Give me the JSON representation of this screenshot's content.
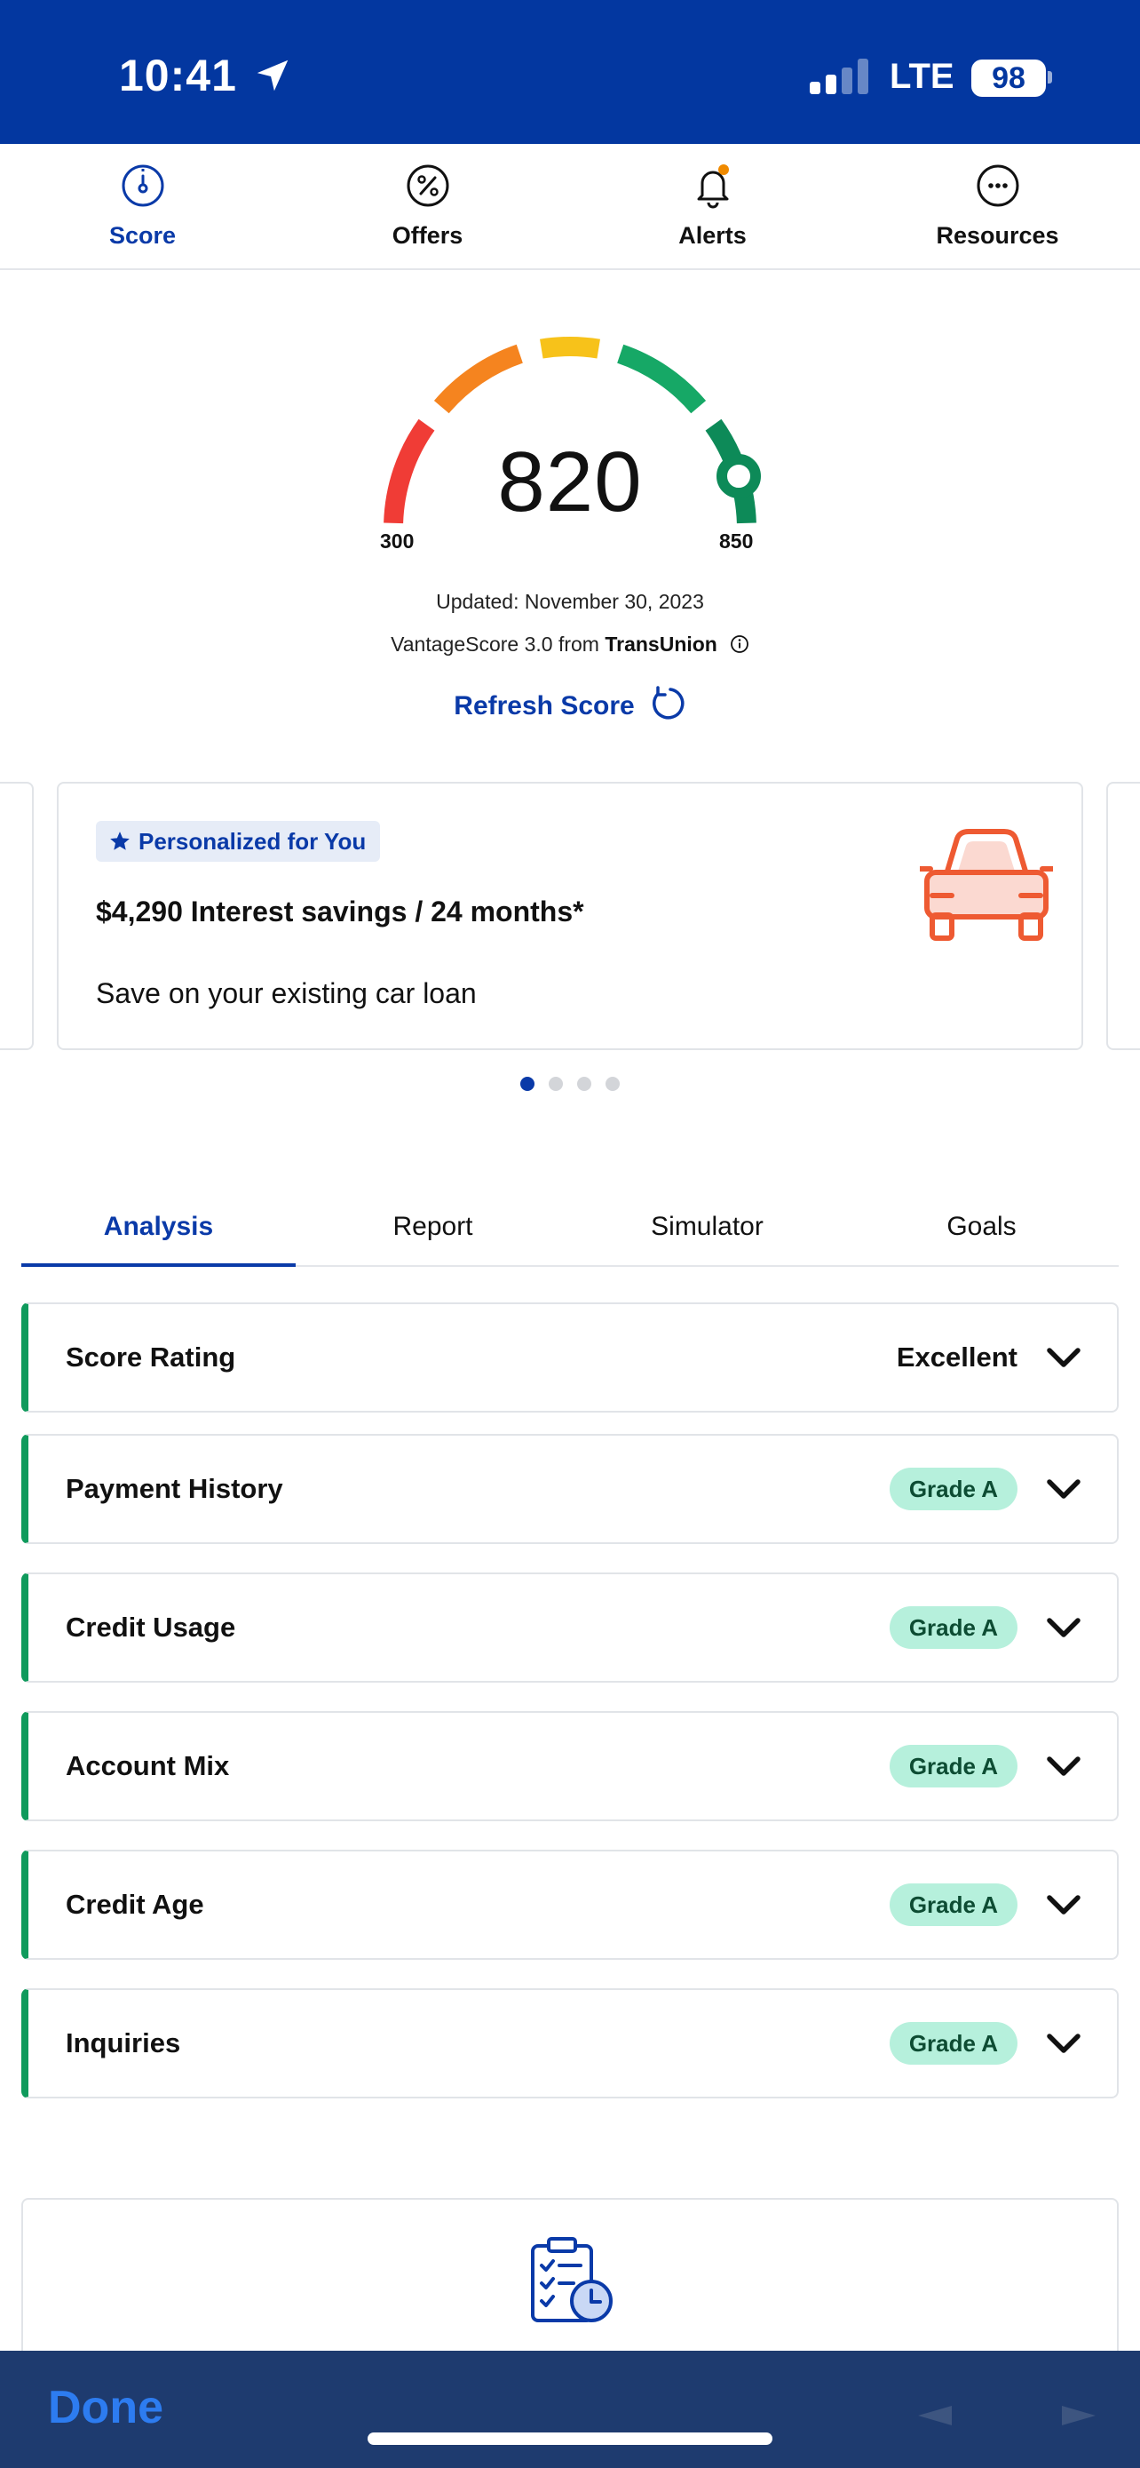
{
  "status_bar": {
    "time": "10:41",
    "network": "LTE",
    "battery": "98"
  },
  "nav": {
    "items": [
      {
        "label": "Score",
        "icon": "gauge-icon",
        "active": true
      },
      {
        "label": "Offers",
        "icon": "percent-icon",
        "active": false
      },
      {
        "label": "Alerts",
        "icon": "bell-icon",
        "active": false
      },
      {
        "label": "Resources",
        "icon": "more-icon",
        "active": false
      }
    ]
  },
  "score": {
    "value": "820",
    "min": "300",
    "max": "850",
    "updated": "Updated: November 30, 2023",
    "source_prefix": "VantageScore 3.0 from ",
    "source_bureau": "TransUnion",
    "refresh_label": "Refresh Score"
  },
  "offer": {
    "badge": "Personalized for You",
    "title": "$4,290 Interest savings / 24 months*",
    "subtitle": "Save on your existing car loan",
    "icon": "car-icon",
    "page_count": 4,
    "active_page": 1
  },
  "tabs": [
    {
      "label": "Analysis",
      "active": true
    },
    {
      "label": "Report",
      "active": false
    },
    {
      "label": "Simulator",
      "active": false
    },
    {
      "label": "Goals",
      "active": false
    }
  ],
  "factors": [
    {
      "label": "Score Rating",
      "value": "Excellent"
    },
    {
      "label": "Payment History",
      "grade": "Grade A"
    },
    {
      "label": "Credit Usage",
      "grade": "Grade A"
    },
    {
      "label": "Account Mix",
      "grade": "Grade A"
    },
    {
      "label": "Credit Age",
      "grade": "Grade A"
    },
    {
      "label": "Inquiries",
      "grade": "Grade A"
    }
  ],
  "browser": {
    "done_label": "Done"
  },
  "colors": {
    "brand_blue": "#0337a0",
    "accent_blue": "#0a3aa8",
    "good_green": "#0f9a5c",
    "grade_bg": "#b6f0dc",
    "offer_orange": "#ee5a32"
  }
}
